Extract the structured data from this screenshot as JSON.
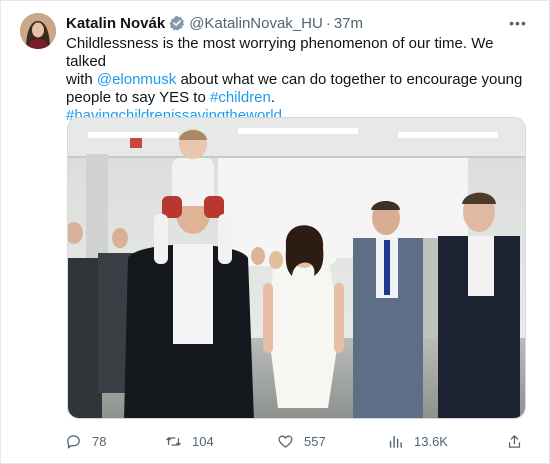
{
  "author": {
    "name": "Katalin Novák",
    "handle": "@KatalinNovak_HU",
    "separator": "·",
    "time": "37m"
  },
  "tweet": {
    "line1": "Childlessness is the most worrying phenomenon of our time. We talked",
    "line2_prefix": "with ",
    "mention": "@elonmusk",
    "line2_suffix": " about what we can do together to encourage young",
    "line3_prefix": "people to say YES to ",
    "hashtag1": "#children",
    "line3_suffix": ".",
    "hashtag2": "#havingchildrenissavingtheworld"
  },
  "more_label": "•••",
  "media": {
    "icon": "photo"
  },
  "actions": {
    "replies": "78",
    "retweets": "104",
    "likes": "557",
    "views": "13.6K"
  },
  "colors": {
    "link": "#1d9bf0",
    "secondary_text": "#536471",
    "primary_text": "#0f1419"
  }
}
